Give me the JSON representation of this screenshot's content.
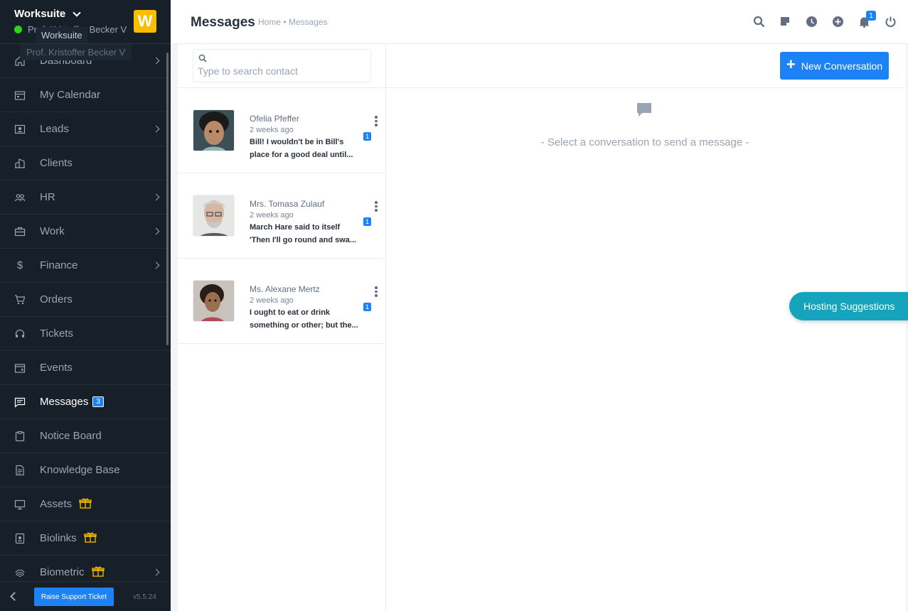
{
  "sidebar": {
    "app_name": "Worksuite",
    "user_name": "Prof. Kristoffer Becker V",
    "logo_letter": "W",
    "tooltip_app": "Worksuite",
    "tooltip_user": "Prof. Kristoffer Becker V",
    "items": [
      {
        "label": "Dashboard",
        "icon": "house-icon",
        "has_arrow": true
      },
      {
        "label": "My Calendar",
        "icon": "calendar-icon",
        "has_arrow": false
      },
      {
        "label": "Leads",
        "icon": "id-card-icon",
        "has_arrow": true
      },
      {
        "label": "Clients",
        "icon": "buildings-icon",
        "has_arrow": false
      },
      {
        "label": "HR",
        "icon": "people-icon",
        "has_arrow": true
      },
      {
        "label": "Work",
        "icon": "briefcase-icon",
        "has_arrow": true
      },
      {
        "label": "Finance",
        "icon": "dollar-icon",
        "has_arrow": true
      },
      {
        "label": "Orders",
        "icon": "cart-icon",
        "has_arrow": false
      },
      {
        "label": "Tickets",
        "icon": "headset-icon",
        "has_arrow": false
      },
      {
        "label": "Events",
        "icon": "calendar-event-icon",
        "has_arrow": false
      },
      {
        "label": "Messages",
        "icon": "chat-icon",
        "has_arrow": false,
        "badge": "3",
        "active": true
      },
      {
        "label": "Notice Board",
        "icon": "clipboard-icon",
        "has_arrow": false
      },
      {
        "label": "Knowledge Base",
        "icon": "document-icon",
        "has_arrow": false
      },
      {
        "label": "Assets",
        "icon": "monitor-icon",
        "has_arrow": false,
        "gift": true
      },
      {
        "label": "Biolinks",
        "icon": "person-badge-icon",
        "has_arrow": false,
        "gift": true
      },
      {
        "label": "Biometric",
        "icon": "fingerprint-icon",
        "has_arrow": true,
        "gift": true
      }
    ],
    "support_button": "Raise Support Ticket",
    "version": "v5.5.24"
  },
  "header": {
    "title": "Messages",
    "breadcrumb": "Home • Messages",
    "notification_count": "1"
  },
  "search": {
    "placeholder": "Type to search contact",
    "value": ""
  },
  "contacts": [
    {
      "name": "Ofelia Pfeffer",
      "time": "2 weeks ago",
      "line1": "Bill! I wouldn't be in Bill's",
      "line2": "place for a good deal until...",
      "unread": "1"
    },
    {
      "name": "Mrs. Tomasa Zulauf",
      "time": "2 weeks ago",
      "line1": "March Hare said to itself",
      "line2": "'Then I'll go round and swa...",
      "unread": "1"
    },
    {
      "name": "Ms. Alexane Mertz",
      "time": "2 weeks ago",
      "line1": "I ought to eat or drink",
      "line2": "something or other; but the...",
      "unread": "1"
    }
  ],
  "chat": {
    "new_conversation_label": "New Conversation",
    "empty_message": "- Select a conversation to send a message -"
  },
  "hosting": {
    "label": "Hosting Suggestions"
  },
  "colors": {
    "sidebar_bg": "#171f29",
    "accent": "#1d82f5",
    "brand_logo": "#fcbd01",
    "hosting": "#16a3bc",
    "online": "#2ad61a"
  }
}
